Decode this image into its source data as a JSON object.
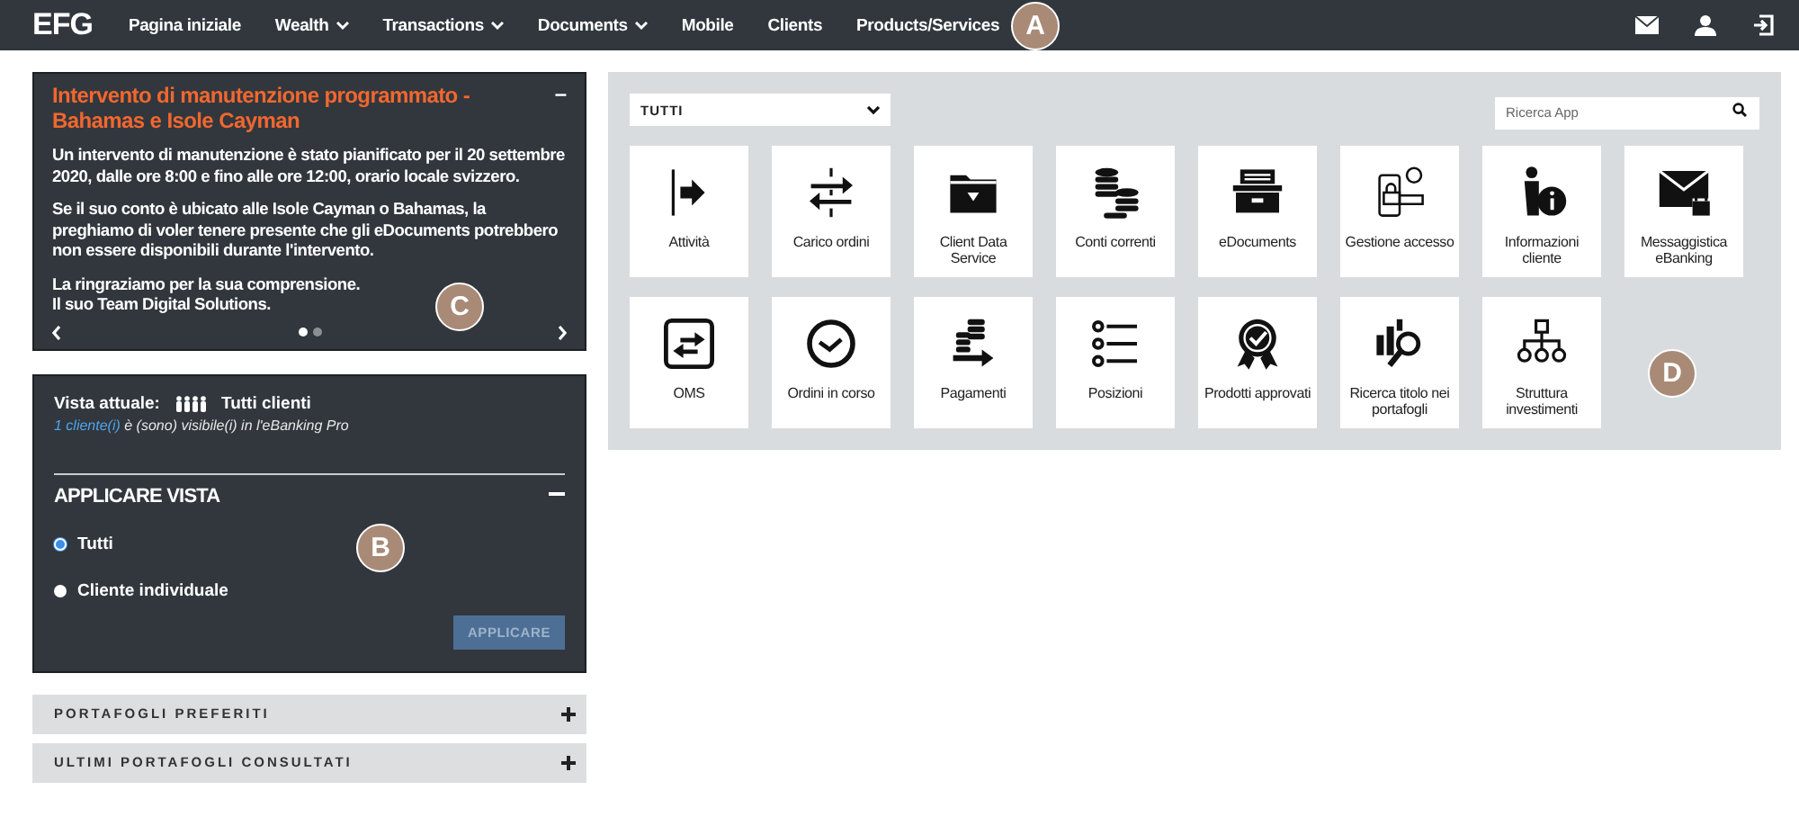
{
  "nav": {
    "logo": "EFG",
    "items": [
      {
        "label": "Pagina iniziale",
        "has_menu": false
      },
      {
        "label": "Wealth",
        "has_menu": true
      },
      {
        "label": "Transactions",
        "has_menu": true
      },
      {
        "label": "Documents",
        "has_menu": true
      },
      {
        "label": "Mobile",
        "has_menu": false
      },
      {
        "label": "Clients",
        "has_menu": false
      },
      {
        "label": "Products/Services",
        "has_menu": false
      }
    ]
  },
  "notice": {
    "title": "Intervento di manutenzione programmato - Bahamas e Isole Cayman",
    "collapse": "–",
    "paragraphs": [
      "Un intervento di manutenzione è stato pianificato per il 20 settembre 2020, dalle ore 8:00 e fino alle ore 12:00, orario locale svizzero.",
      "Se il suo conto è ubicato alle Isole Cayman o Bahamas, la preghiamo di voler tenere presente che gli eDocuments potrebbero non essere disponibili durante l'intervento.",
      "La ringraziamo per la sua comprensione.\nIl suo Team Digital Solutions."
    ],
    "pages": [
      {
        "selected": true
      },
      {
        "selected": false
      }
    ]
  },
  "view": {
    "label": "Vista attuale:",
    "current": "Tutti clienti",
    "link": "1 cliente(i)",
    "info": " è (sono) visibile(i) in l'eBanking Pro",
    "heading": "APPLICARE VISTA",
    "options": [
      {
        "label": "Tutti",
        "selected": true
      },
      {
        "label": "Cliente individuale",
        "selected": false
      }
    ],
    "button": {
      "label": "APPLICARE",
      "disabled": true
    }
  },
  "accordions": [
    {
      "label": "PORTAFOGLI PREFERITI",
      "expanded": false
    },
    {
      "label": "ULTIMI PORTAFOGLI CONSULTATI",
      "expanded": false
    }
  ],
  "apps": {
    "filter": "TUTTI",
    "search": {
      "placeholder": "Ricerca App"
    },
    "tiles": [
      {
        "label": "Attività"
      },
      {
        "label": "Carico ordini"
      },
      {
        "label": "Client Data Service"
      },
      {
        "label": "Conti correnti"
      },
      {
        "label": "eDocuments"
      },
      {
        "label": "Gestione accesso"
      },
      {
        "label": "Informazioni cliente"
      },
      {
        "label": "Messaggistica eBanking"
      },
      {
        "label": "OMS"
      },
      {
        "label": "Ordini in corso"
      },
      {
        "label": "Pagamenti"
      },
      {
        "label": "Posizioni"
      },
      {
        "label": "Prodotti approvati"
      },
      {
        "label": "Ricerca titolo nei portafogli"
      },
      {
        "label": "Struttura investimenti"
      }
    ]
  },
  "callouts": [
    {
      "label": "A"
    },
    {
      "label": "B"
    },
    {
      "label": "C"
    },
    {
      "label": "D"
    }
  ]
}
